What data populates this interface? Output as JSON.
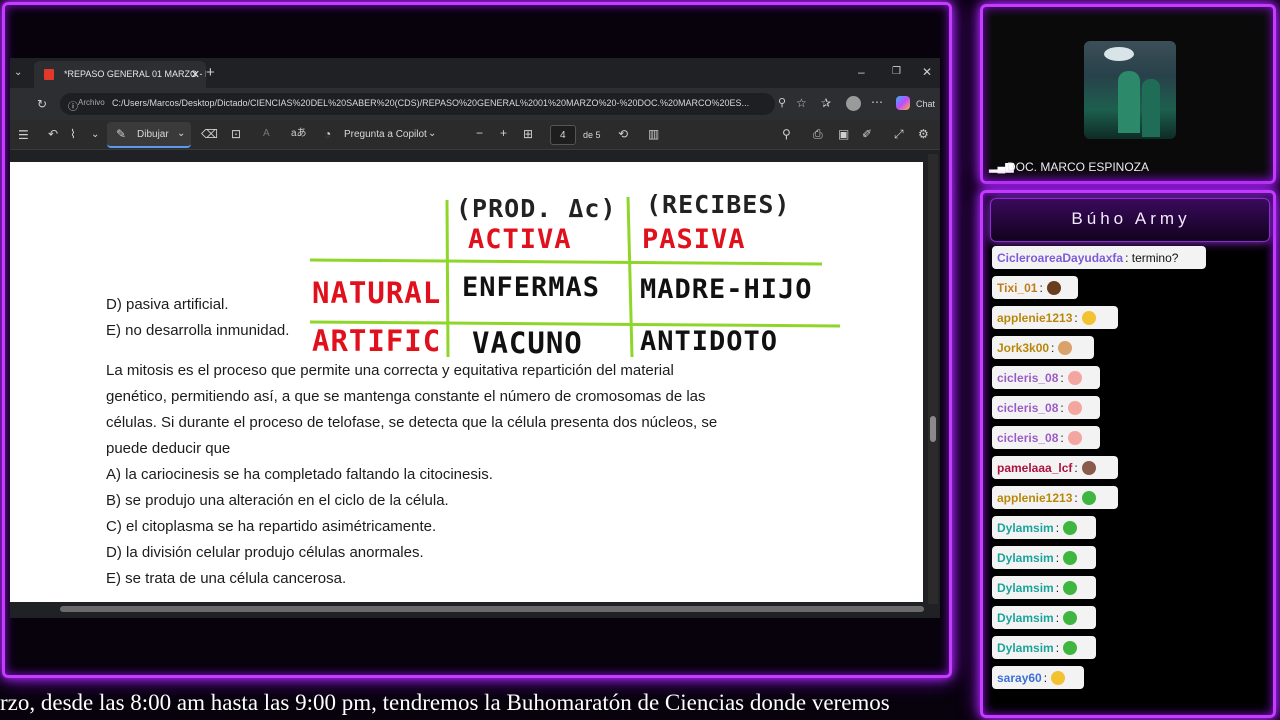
{
  "browser": {
    "tab_title": "*REPASO GENERAL 01 MARZO - D",
    "address_label": "Archivo",
    "address": "C:/Users/Marcos/Desktop/Dictado/CIENCIAS%20DEL%20SABER%20(CDS)/REPASO%20GENERAL%2001%20MARZO%20-%20DOC.%20MARCO%20ES...",
    "chat_button": "Chat"
  },
  "pdf_toolbar": {
    "draw_label": "Dibujar",
    "copilot_label": "Pregunta a Copilot",
    "page_current": "4",
    "page_total": "de 5"
  },
  "document": {
    "options_prev": [
      "D) pasiva artificial.",
      "E) no desarrolla inmunidad."
    ],
    "question": [
      "La mitosis es el proceso que permite una correcta y equitativa repartición del material",
      "genético, permitiendo así, a que se mantenga constante el número de cromosomas de las",
      "células. Si durante el proceso de telofase, se detecta que la célula presenta dos núcleos, se",
      "puede deducir que"
    ],
    "options": [
      "A) la cariocinesis se ha completado faltando la citocinesis.",
      "B) se produjo una alteración en el ciclo de la célula.",
      "C) el citoplasma se ha repartido asimétricamente.",
      "D) la división celular produjo células anormales.",
      "E) se trata de una célula cancerosa."
    ],
    "handwriting": {
      "col1_note": "(PROD. Δc)",
      "col2_note": "(RECIBES)",
      "col1_header": "ACTIVA",
      "col2_header": "PASIVA",
      "row1_label": "NATURAL",
      "row2_label": "ARTIFIC",
      "r1c1": "ENFERMAS",
      "r1c2": "MADRE-HIJO",
      "r2c1": "VACUNO",
      "r2c2": "ANTIDOTO"
    }
  },
  "webcam": {
    "name": "DOC. MARCO ESPINOZA"
  },
  "chat": {
    "title": "Búho Army",
    "messages": [
      {
        "user": "CicleroareaDayudaxfa",
        "text": ": termino?",
        "color": "#7b5bd6"
      },
      {
        "user": "Tixi_01",
        "text": ":",
        "color": "#c07a1a"
      },
      {
        "user": "applenie1213",
        "text": ":",
        "color": "#b8860b"
      },
      {
        "user": "Jork3k00",
        "text": ":",
        "color": "#b8860b"
      },
      {
        "user": "cicleris_08",
        "text": ":",
        "color": "#9a5cc4"
      },
      {
        "user": "cicleris_08",
        "text": ":",
        "color": "#9a5cc4"
      },
      {
        "user": "cicleris_08",
        "text": ":",
        "color": "#9a5cc4"
      },
      {
        "user": "pamelaaa_lcf",
        "text": ":",
        "color": "#a8123e"
      },
      {
        "user": "applenie1213",
        "text": ":",
        "color": "#b8860b"
      },
      {
        "user": "Dylamsim",
        "text": ":",
        "color": "#1aa39a"
      },
      {
        "user": "Dylamsim",
        "text": ":",
        "color": "#1aa39a"
      },
      {
        "user": "Dylamsim",
        "text": ":",
        "color": "#1aa39a"
      },
      {
        "user": "Dylamsim",
        "text": ":",
        "color": "#1aa39a"
      },
      {
        "user": "Dylamsim",
        "text": ":",
        "color": "#1aa39a"
      },
      {
        "user": "saray60",
        "text": ":",
        "color": "#3b6fd6"
      }
    ]
  },
  "ticker": {
    "text": "rzo, desde las 8:00 am hasta las 9:00 pm, tendremos la Buhomaratón de Ciencias donde veremos"
  },
  "colors": {
    "neon": "#c63bff",
    "handwriting_red": "#e0101c",
    "grid_green": "#8fd62a"
  }
}
